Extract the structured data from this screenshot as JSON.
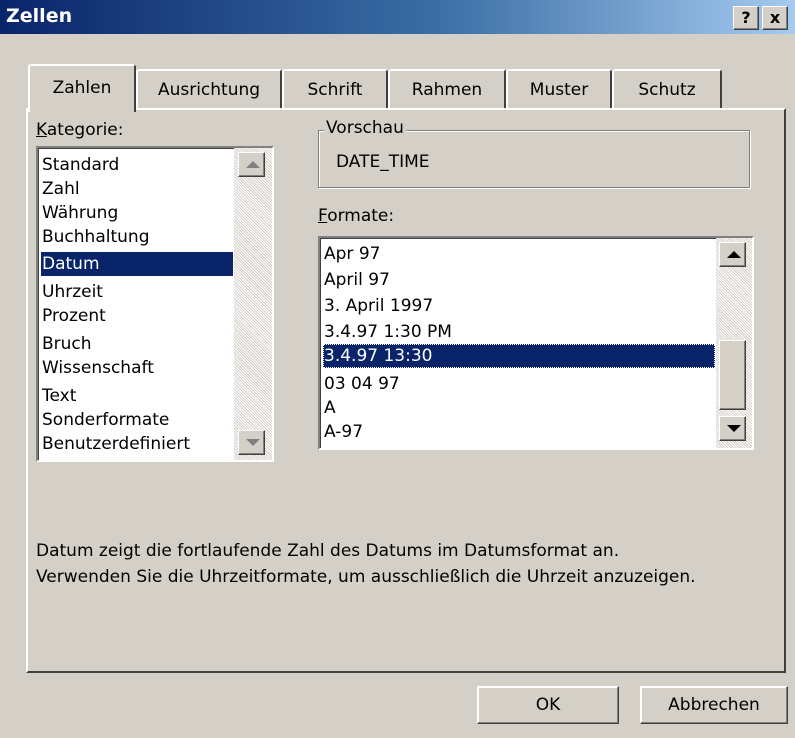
{
  "window": {
    "title": "Zellen",
    "help_btn": "?",
    "close_btn": "x"
  },
  "tabs": [
    {
      "label": "Zahlen",
      "active": true
    },
    {
      "label": "Ausrichtung",
      "active": false
    },
    {
      "label": "Schrift",
      "active": false
    },
    {
      "label": "Rahmen",
      "active": false
    },
    {
      "label": "Muster",
      "active": false
    },
    {
      "label": "Schutz",
      "active": false
    }
  ],
  "category": {
    "label_first": "K",
    "label_rest": "ategorie:",
    "items": [
      "Standard",
      "Zahl",
      "Währung",
      "Buchhaltung",
      "Datum",
      "Uhrzeit",
      "Prozent",
      "Bruch",
      "Wissenschaft",
      "Text",
      "Sonderformate",
      "Benutzerdefiniert"
    ],
    "selected": "Datum"
  },
  "preview": {
    "label": "Vorschau",
    "value": "DATE_TIME"
  },
  "formats": {
    "label_first": "F",
    "label_rest": "ormate:",
    "items": [
      "Apr 97",
      "April 97",
      "3. April 1997",
      "3.4.97 1:30 PM",
      "3.4.97 13:30",
      "03 04 97",
      "A",
      "A-97"
    ],
    "selected": "3.4.97 13:30"
  },
  "description": {
    "line1": "Datum zeigt die fortlaufende Zahl des Datums im Datumsformat an.",
    "line2": "Verwenden Sie die Uhrzeitformate, um ausschließlich die Uhrzeit anzuzeigen."
  },
  "buttons": {
    "ok": "OK",
    "cancel": "Abbrechen"
  },
  "colors": {
    "selection": "#0a246a",
    "face": "#d4d0c8",
    "title_gradient_start": "#0a246a",
    "title_gradient_end": "#a6caf0"
  }
}
